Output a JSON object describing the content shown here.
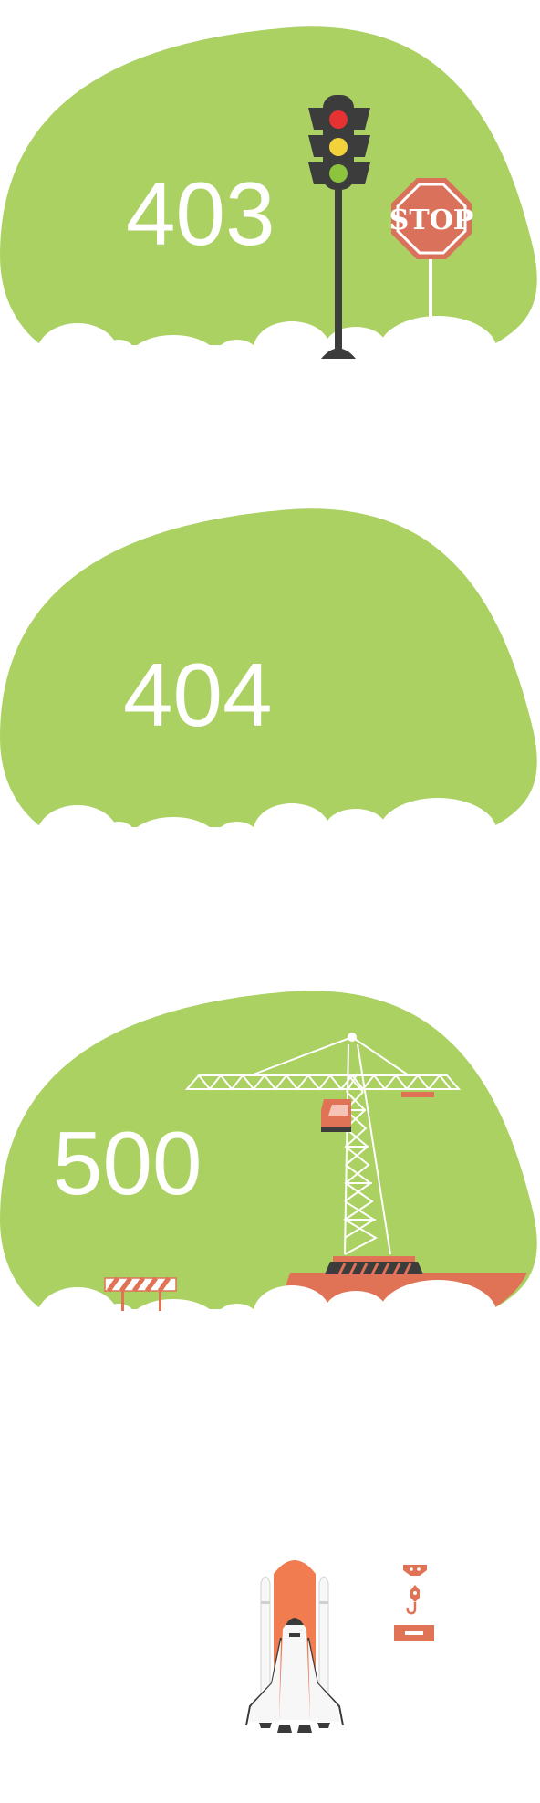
{
  "colors": {
    "blob": "#abd163",
    "cloud": "#ffffff",
    "code_text": "#ffffff",
    "pole": "#3c3c3c",
    "light_red": "#e63233",
    "light_yellow": "#f3d13b",
    "light_green": "#8cc43e",
    "stop_sign": "#d9715b",
    "ground": "#e07356",
    "crane_lines": "#ffffff",
    "shuttle_orange": "#f07c50",
    "shuttle_body": "#f7f7f7",
    "shuttle_dark": "#3a3a3a",
    "hook": "#e07356"
  },
  "error_403": {
    "code": "403",
    "sign_text": "STOP",
    "icons": [
      "traffic-light-icon",
      "stop-sign-icon"
    ]
  },
  "error_404": {
    "code": "404"
  },
  "error_500": {
    "code": "500",
    "icons": [
      "tower-crane-icon",
      "crane-cabin-icon",
      "road-barrier-icon"
    ]
  },
  "error_next": {
    "icons": [
      "space-shuttle-icon",
      "crane-hook-icon"
    ]
  }
}
